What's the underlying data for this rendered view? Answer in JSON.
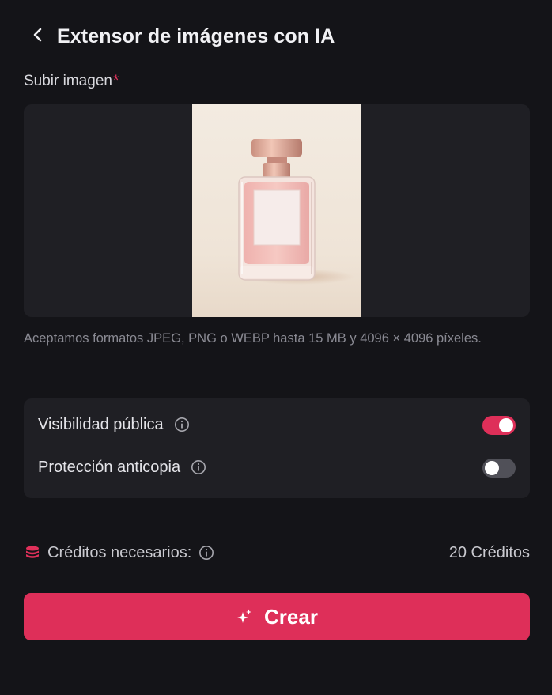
{
  "header": {
    "title": "Extensor de imágenes con IA",
    "back_icon": "chevron-left-icon"
  },
  "upload": {
    "label": "Subir imagen",
    "required_mark": "*",
    "hint": "Aceptamos formatos JPEG, PNG o WEBP hasta 15 MB y 4096 × 4096 píxeles."
  },
  "options": [
    {
      "label": "Visibilidad pública",
      "enabled": true,
      "info_icon": "info-icon"
    },
    {
      "label": "Protección anticopia",
      "enabled": false,
      "info_icon": "info-icon"
    }
  ],
  "credits": {
    "label": "Créditos necesarios:",
    "value": "20 Créditos",
    "icon": "coins-icon"
  },
  "create_button": {
    "label": "Crear",
    "icon": "sparkle-icon"
  },
  "colors": {
    "background": "#141418",
    "panel": "#1f1f24",
    "accent": "#de2f59",
    "toggle_off": "#505058"
  }
}
